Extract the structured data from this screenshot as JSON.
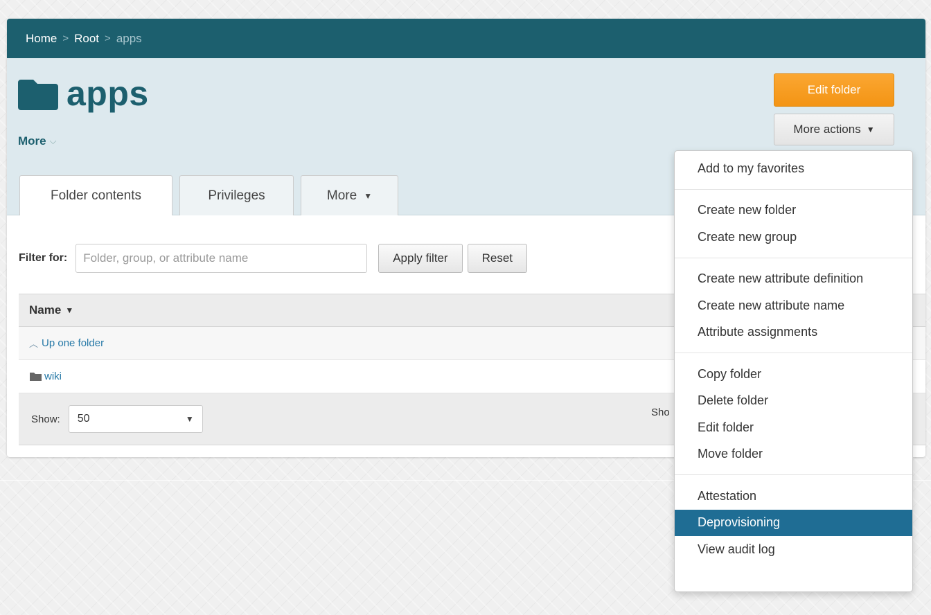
{
  "breadcrumb": {
    "home": "Home",
    "root": "Root",
    "current": "apps",
    "separator": ">"
  },
  "header": {
    "title": "apps",
    "more_label": "More",
    "more_chevron": "⌵"
  },
  "tabs": [
    {
      "label": "Folder contents",
      "active": true
    },
    {
      "label": "Privileges",
      "active": false
    },
    {
      "label": "More",
      "active": false
    }
  ],
  "actions": {
    "edit_folder": "Edit folder",
    "more_actions": "More actions"
  },
  "filter": {
    "label": "Filter for:",
    "placeholder": "Folder, group, or attribute name",
    "value": "",
    "apply_label": "Apply filter",
    "reset_label": "Reset"
  },
  "table": {
    "header": "Name",
    "rows": [
      {
        "label": "Up one folder",
        "icon": "chevron-up-icon"
      },
      {
        "label": "wiki",
        "icon": "folder-icon"
      }
    ],
    "footer": {
      "show_label": "Show:",
      "show_value": "50",
      "showing_text": "Sho"
    }
  },
  "dropdown": {
    "groups": [
      [
        "Add to my favorites"
      ],
      [
        "Create new folder",
        "Create new group"
      ],
      [
        "Create new attribute definition",
        "Create new attribute name",
        "Attribute assignments"
      ],
      [
        "Copy folder",
        "Delete folder",
        "Edit folder",
        "Move folder"
      ],
      [
        "Attestation",
        "Deprovisioning",
        "View audit log"
      ]
    ],
    "highlighted": "Deprovisioning"
  },
  "colors": {
    "brand": "#1c5f6e",
    "accent_orange": "#f39414",
    "link": "#2779a7",
    "highlight": "#1f6d94"
  }
}
